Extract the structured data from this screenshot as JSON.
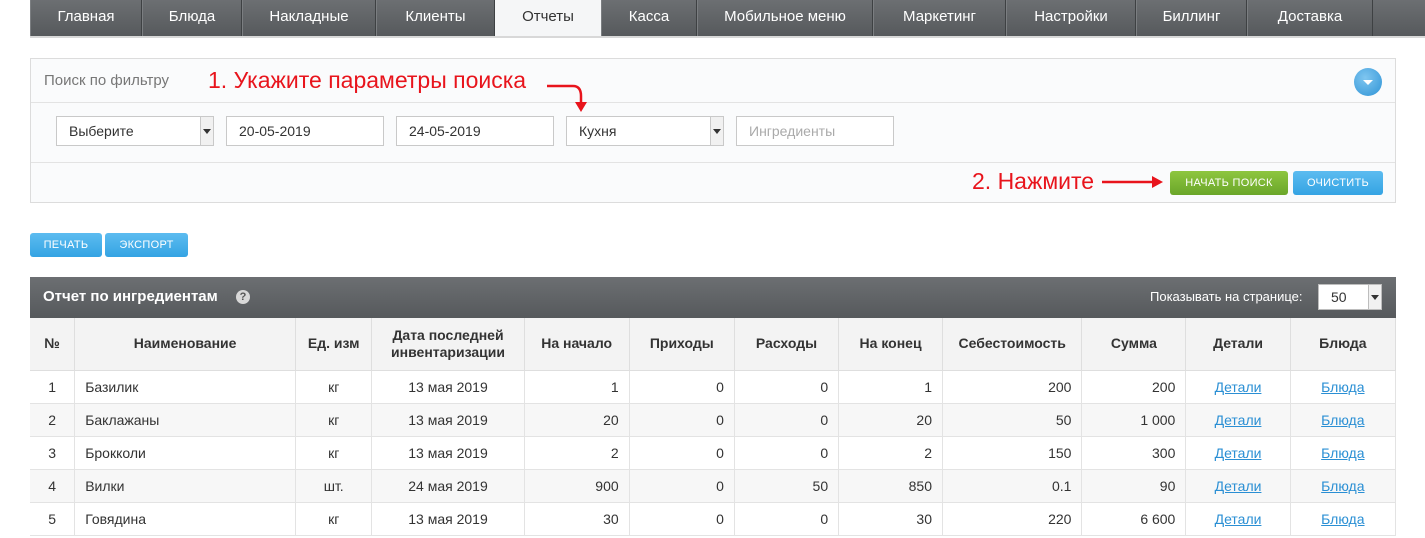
{
  "nav": {
    "tabs": [
      {
        "label": "Главная"
      },
      {
        "label": "Блюда"
      },
      {
        "label": "Накладные"
      },
      {
        "label": "Клиенты"
      },
      {
        "label": "Отчеты"
      },
      {
        "label": "Касса"
      },
      {
        "label": "Мобильное меню"
      },
      {
        "label": "Маркетинг"
      },
      {
        "label": "Настройки"
      },
      {
        "label": "Биллинг"
      },
      {
        "label": "Доставка"
      }
    ],
    "active": "Отчеты"
  },
  "filter": {
    "title": "Поиск по фильтру",
    "type_select": "Выберите",
    "date_from": "20-05-2019",
    "date_to": "24-05-2019",
    "place_select": "Кухня",
    "ingredients_placeholder": "Ингредиенты",
    "search_button": "НАЧАТЬ ПОИСК",
    "clear_button": "ОЧИСТИТЬ"
  },
  "annotations": {
    "step1": "1. Укажите параметры поиска",
    "step2": "2. Нажмите"
  },
  "actions": {
    "print": "ПЕЧАТЬ",
    "export": "ЭКСПОРТ"
  },
  "report": {
    "title": "Отчет по ингредиентам",
    "help": "?",
    "per_page_label": "Показывать на странице:",
    "per_page_value": "50",
    "columns": [
      "№",
      "Наименование",
      "Ед. изм",
      "Дата последней инвентаризации",
      "На начало",
      "Приходы",
      "Расходы",
      "На конец",
      "Себестоимость",
      "Сумма",
      "Детали",
      "Блюда"
    ],
    "rows": [
      {
        "n": "1",
        "name": "Базилик",
        "unit": "кг",
        "date": "13 мая 2019",
        "start": "1",
        "in": "0",
        "out": "0",
        "end": "1",
        "cost": "200",
        "sum": "200",
        "details": "Детали",
        "dishes": "Блюда"
      },
      {
        "n": "2",
        "name": "Баклажаны",
        "unit": "кг",
        "date": "13 мая 2019",
        "start": "20",
        "in": "0",
        "out": "0",
        "end": "20",
        "cost": "50",
        "sum": "1 000",
        "details": "Детали",
        "dishes": "Блюда"
      },
      {
        "n": "3",
        "name": "Брокколи",
        "unit": "кг",
        "date": "13 мая 2019",
        "start": "2",
        "in": "0",
        "out": "0",
        "end": "2",
        "cost": "150",
        "sum": "300",
        "details": "Детали",
        "dishes": "Блюда"
      },
      {
        "n": "4",
        "name": "Вилки",
        "unit": "шт.",
        "date": "24 мая 2019",
        "start": "900",
        "in": "0",
        "out": "50",
        "end": "850",
        "cost": "0.1",
        "sum": "90",
        "details": "Детали",
        "dishes": "Блюда"
      },
      {
        "n": "5",
        "name": "Говядина",
        "unit": "кг",
        "date": "13 мая 2019",
        "start": "30",
        "in": "0",
        "out": "0",
        "end": "30",
        "cost": "220",
        "sum": "6 600",
        "details": "Детали",
        "dishes": "Блюда"
      }
    ]
  }
}
